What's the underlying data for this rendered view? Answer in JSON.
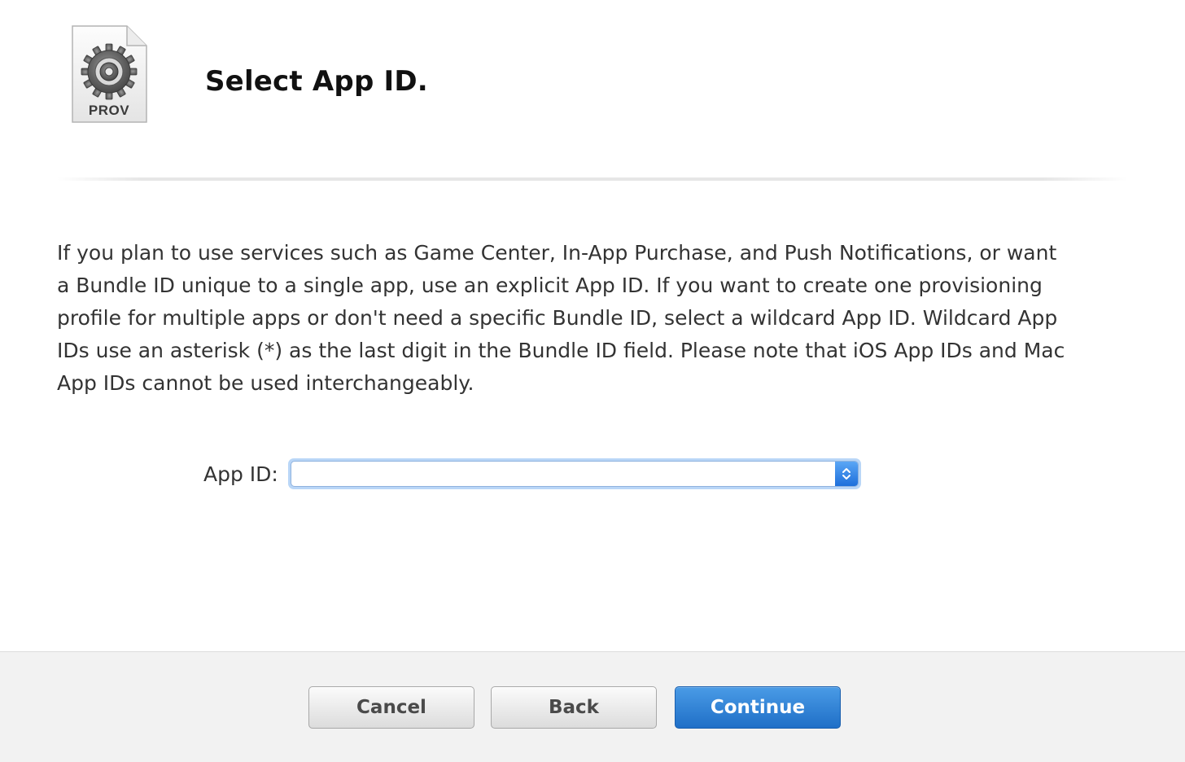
{
  "header": {
    "icon_name": "provisioning-profile-icon",
    "icon_label": "PROV",
    "title": "Select App ID."
  },
  "main": {
    "description": "If you plan to use services such as Game Center, In-App Purchase, and Push Notifications, or want a Bundle ID unique to a single app, use an explicit App ID. If you want to create one provisioning profile for multiple apps or don't need a specific Bundle ID, select a wildcard App ID. Wildcard App IDs use an asterisk (*) as the last digit in the Bundle ID field. Please note that iOS App IDs and Mac App IDs cannot be used interchangeably.",
    "app_id_field": {
      "label": "App ID:",
      "selected_value": ""
    }
  },
  "footer": {
    "cancel_label": "Cancel",
    "back_label": "Back",
    "continue_label": "Continue"
  },
  "colors": {
    "primary_button": "#1f6fc7",
    "focus_ring": "#b9d6f7",
    "footer_bg": "#f2f2f2"
  }
}
